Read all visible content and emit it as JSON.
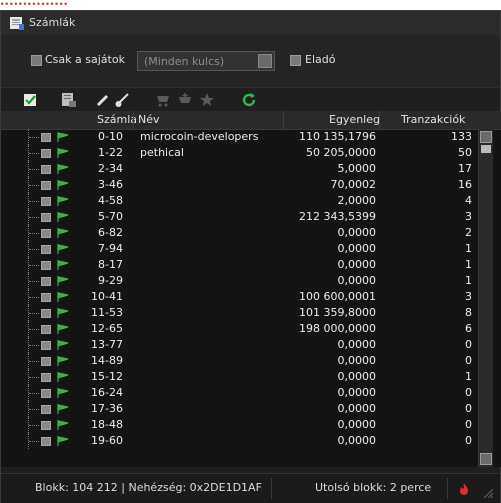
{
  "cropped_header_text": "...............",
  "window": {
    "title": "Számlák"
  },
  "filters": {
    "own_only_label": "Csak a sajátok",
    "key_select_value": "(Minden kulcs)",
    "seller_label": "Eladó"
  },
  "table": {
    "columns": [
      "Számla",
      "Név",
      "Egyenleg",
      "Tranzakciók"
    ],
    "rows": [
      {
        "account": "0-10",
        "name": "microcoin-developers",
        "balance": "110 135,1796",
        "tx": "133"
      },
      {
        "account": "1-22",
        "name": "pethical",
        "balance": "50 205,0000",
        "tx": "50"
      },
      {
        "account": "2-34",
        "name": "",
        "balance": "5,0000",
        "tx": "17"
      },
      {
        "account": "3-46",
        "name": "",
        "balance": "70,0002",
        "tx": "16"
      },
      {
        "account": "4-58",
        "name": "",
        "balance": "2,0000",
        "tx": "4"
      },
      {
        "account": "5-70",
        "name": "",
        "balance": "212 343,5399",
        "tx": "3"
      },
      {
        "account": "6-82",
        "name": "",
        "balance": "0,0000",
        "tx": "2"
      },
      {
        "account": "7-94",
        "name": "",
        "balance": "0,0000",
        "tx": "1"
      },
      {
        "account": "8-17",
        "name": "",
        "balance": "0,0000",
        "tx": "1"
      },
      {
        "account": "9-29",
        "name": "",
        "balance": "0,0000",
        "tx": "1"
      },
      {
        "account": "10-41",
        "name": "",
        "balance": "100 600,0001",
        "tx": "3"
      },
      {
        "account": "11-53",
        "name": "",
        "balance": "101 359,8000",
        "tx": "8"
      },
      {
        "account": "12-65",
        "name": "",
        "balance": "198 000,0000",
        "tx": "6"
      },
      {
        "account": "13-77",
        "name": "",
        "balance": "0,0000",
        "tx": "0"
      },
      {
        "account": "14-89",
        "name": "",
        "balance": "0,0000",
        "tx": "0"
      },
      {
        "account": "15-12",
        "name": "",
        "balance": "0,0000",
        "tx": "1"
      },
      {
        "account": "16-24",
        "name": "",
        "balance": "0,0000",
        "tx": "0"
      },
      {
        "account": "17-36",
        "name": "",
        "balance": "0,0000",
        "tx": "0"
      },
      {
        "account": "18-48",
        "name": "",
        "balance": "0,0000",
        "tx": "0"
      },
      {
        "account": "19-60",
        "name": "",
        "balance": "0,0000",
        "tx": "0"
      }
    ]
  },
  "status": {
    "block_info": "Blokk: 104 212 | Nehézség: 0x2DE1D1AF",
    "last_block": "Utolsó blokk: 2 perce"
  },
  "colors": {
    "accent_green": "#2db84a",
    "status_red": "#e02b2b"
  },
  "icons": [
    "app-icon",
    "check-icon",
    "document-icon",
    "pencil-icon",
    "brush-icon",
    "cart-icon",
    "cart-add-icon",
    "star-icon",
    "refresh-icon",
    "flag-icon",
    "fire-icon",
    "resize-grip-icon"
  ]
}
